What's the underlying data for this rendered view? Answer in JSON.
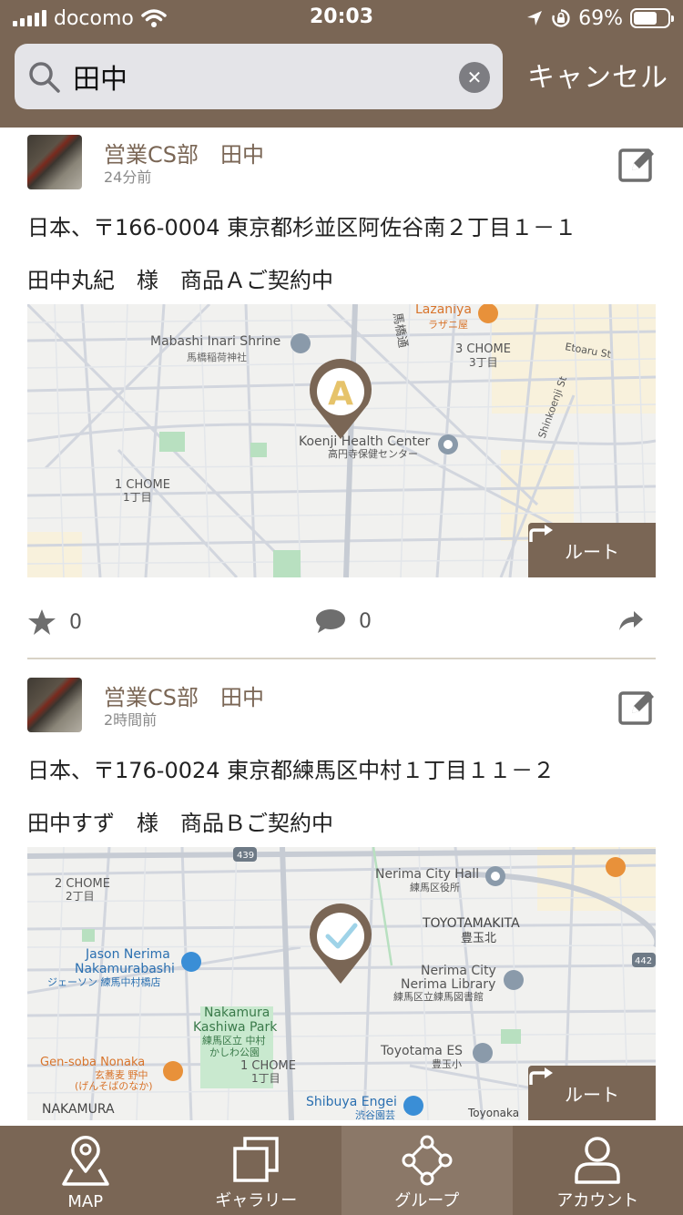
{
  "status_bar": {
    "carrier": "docomo",
    "time": "20:03",
    "battery": "69%",
    "battery_level": 0.69
  },
  "search": {
    "query": "田中",
    "cancel_label": "キャンセル"
  },
  "posts": [
    {
      "author": "営業CS部　田中",
      "time": "24分前",
      "address": "日本、〒166-0004 東京都杉並区阿佐谷南２丁目１－１",
      "note": "田中丸紀　様　商品Ａご契約中",
      "route_label": "ルート",
      "likes": "0",
      "comments": "0",
      "map_pin": "A",
      "map_labels": {
        "shrine_en": "Mabashi Inari Shrine",
        "shrine_jp": "馬橋稲荷神社",
        "lazaniya_en": "Lazaniya",
        "lazaniya_jp": "ラザニ屋",
        "chome3_en": "3 CHOME",
        "chome3_jp": "3丁目",
        "etoaru": "Etoaru St",
        "shinkoenji": "Shinkoenji St",
        "health_en": "Koenji Health Center",
        "health_jp": "高円寺保健センター",
        "chome1_en": "1 CHOME",
        "chome1_jp": "1丁目",
        "mabashi_road": "馬橋通"
      }
    },
    {
      "author": "営業CS部　田中",
      "time": "2時間前",
      "address": "日本、〒176-0024 東京都練馬区中村１丁目１１－２",
      "note": "田中すず　様　商品Ｂご契約中",
      "route_label": "ルート",
      "map_labels": {
        "route439": "439",
        "chome2_en": "2 CHOME",
        "chome2_jp": "2丁目",
        "cityhall_en": "Nerima City Hall",
        "cityhall_jp": "練馬区役所",
        "toyotama_en": "TOYOTAMAKITA",
        "toyotama_jp": "豊玉北",
        "jason_en1": "Jason Nerima",
        "jason_en2": "Nakamurabashi",
        "jason_jp": "ジェーソン 練馬中村橋店",
        "library_en1": "Nerima City",
        "library_en2": "Nerima Library",
        "library_jp": "練馬区立練馬図書館",
        "route442": "442",
        "park_en1": "Nakamura",
        "park_en2": "Kashiwa Park",
        "park_jp1": "練馬区立 中村",
        "park_jp2": "かしわ公園",
        "school_en": "Toyotama ES",
        "school_jp": "豊玉小",
        "soba_en": "Gen-soba Nonaka",
        "soba_jp1": "玄蕎麦 野中",
        "soba_jp2": "(げんそばのなか)",
        "chome1_en": "1 CHOME",
        "chome1_jp": "1丁目",
        "nakamura_en": "NAKAMURA",
        "engei_en": "Shibuya Engei",
        "engei_jp": "渋谷園芸",
        "toyonaka": "Toyonaka"
      }
    }
  ],
  "tabs": [
    {
      "label": "MAP",
      "icon": "map-pin-icon"
    },
    {
      "label": "ギャラリー",
      "icon": "gallery-icon"
    },
    {
      "label": "グループ",
      "icon": "group-icon",
      "active": true
    },
    {
      "label": "アカウント",
      "icon": "account-icon"
    }
  ],
  "colors": {
    "brand": "#7a6655",
    "active_tab": "#8b7868",
    "pin_letter": "#e6c36a",
    "pin_check": "#9fd3e8"
  }
}
